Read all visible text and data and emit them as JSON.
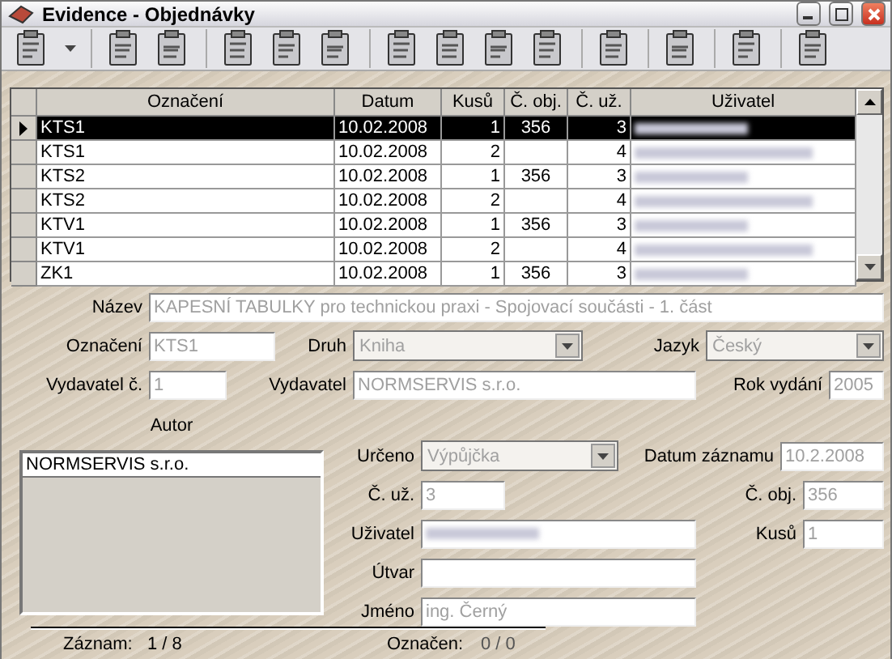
{
  "window": {
    "title": "Evidence - Objednávky"
  },
  "table": {
    "columns": [
      "Označení",
      "Datum",
      "Kusů",
      "Č. obj.",
      "Č. už.",
      "Uživatel"
    ],
    "rows": [
      {
        "cells": [
          "KTS1",
          "10.02.2008",
          "1",
          "356",
          "3"
        ],
        "user_redacted": true,
        "selected": true
      },
      {
        "cells": [
          "KTS1",
          "10.02.2008",
          "2",
          "",
          "4"
        ],
        "user_redacted": true,
        "selected": false
      },
      {
        "cells": [
          "KTS2",
          "10.02.2008",
          "1",
          "356",
          "3"
        ],
        "user_redacted": true,
        "selected": false
      },
      {
        "cells": [
          "KTS2",
          "10.02.2008",
          "2",
          "",
          "4"
        ],
        "user_redacted": true,
        "selected": false
      },
      {
        "cells": [
          "KTV1",
          "10.02.2008",
          "1",
          "356",
          "3"
        ],
        "user_redacted": true,
        "selected": false
      },
      {
        "cells": [
          "KTV1",
          "10.02.2008",
          "2",
          "",
          "4"
        ],
        "user_redacted": true,
        "selected": false
      },
      {
        "cells": [
          "ZK1",
          "10.02.2008",
          "1",
          "356",
          "3"
        ],
        "user_redacted": true,
        "selected": false
      }
    ]
  },
  "form": {
    "nazev": {
      "label": "Název",
      "value": "KAPESNÍ TABULKY pro technickou praxi - Spojovací součásti - 1. část",
      "disabled": true
    },
    "oznaceni": {
      "label": "Označení",
      "value": "KTS1",
      "disabled": true
    },
    "druh": {
      "label": "Druh",
      "value": "Kniha",
      "disabled": true
    },
    "jazyk": {
      "label": "Jazyk",
      "value": "Český",
      "disabled": true
    },
    "vydavatel_c": {
      "label": "Vydavatel č.",
      "value": "1",
      "disabled": true
    },
    "vydavatel": {
      "label": "Vydavatel",
      "value": "NORMSERVIS s.r.o.",
      "disabled": true
    },
    "rok_vydani": {
      "label": "Rok vydání",
      "value": "2005",
      "disabled": true
    },
    "autor": {
      "label": "Autor",
      "items": [
        "NORMSERVIS s.r.o."
      ]
    },
    "urceno": {
      "label": "Určeno",
      "value": "Výpůjčka",
      "disabled": true
    },
    "datum_zaznamu": {
      "label": "Datum záznamu",
      "value": "10.2.2008",
      "disabled": true
    },
    "c_uz": {
      "label": "Č. už.",
      "value": "3",
      "disabled": true
    },
    "c_obj": {
      "label": "Č. obj.",
      "value": "356",
      "disabled": true
    },
    "uzivatel": {
      "label": "Uživatel",
      "redacted": true
    },
    "kusu": {
      "label": "Kusů",
      "value": "1",
      "disabled": true
    },
    "utvar": {
      "label": "Útvar"
    },
    "jmeno": {
      "label": "Jméno",
      "value": "ing. Černý",
      "disabled": true
    }
  },
  "status_bar": {
    "record_label": "Záznam:",
    "record_value": "1 / 8",
    "marked_label": "Označen:",
    "marked_value": "0 / 0"
  }
}
